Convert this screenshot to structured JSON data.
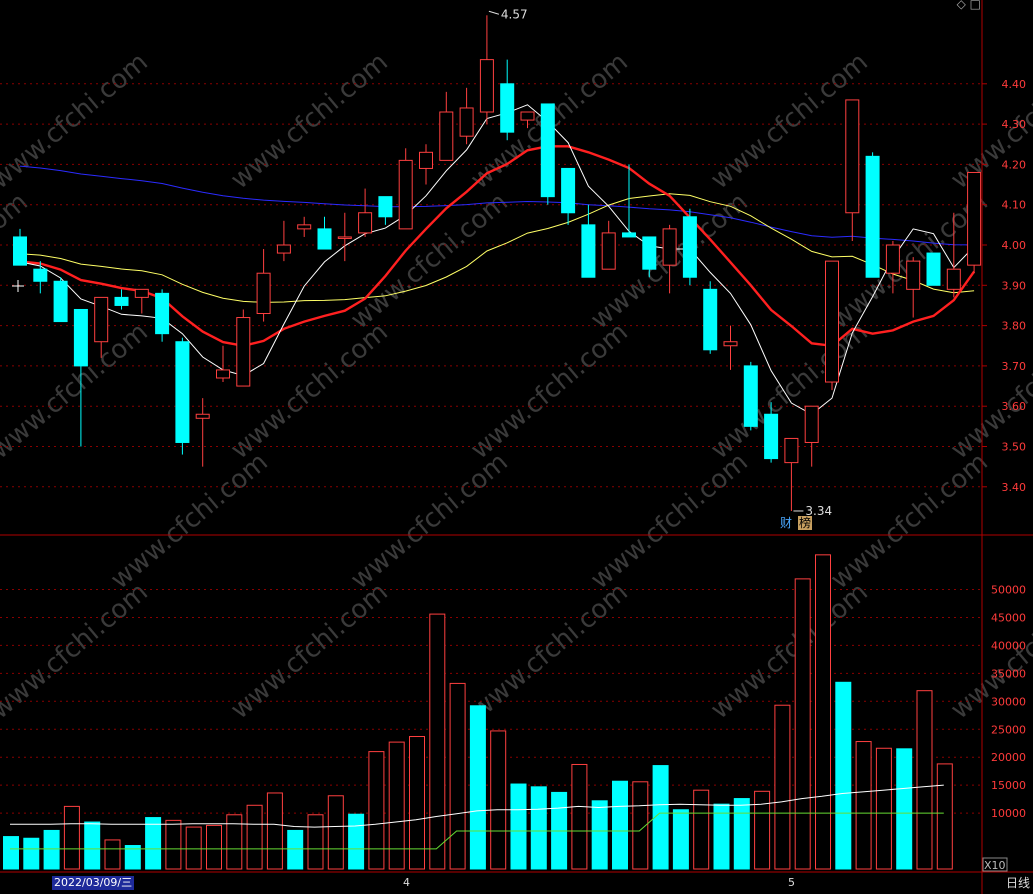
{
  "header": {
    "icons": [
      "diamond-icon",
      "square-icon"
    ]
  },
  "price_axis": {
    "ticks": [
      "4.40",
      "4.30",
      "4.20",
      "4.10",
      "4.00",
      "3.90",
      "3.80",
      "3.70",
      "3.60",
      "3.50",
      "3.40"
    ]
  },
  "volume_axis": {
    "ticks": [
      "50000",
      "45000",
      "40000",
      "35000",
      "30000",
      "25000",
      "20000",
      "15000",
      "10000"
    ],
    "unit": "X10"
  },
  "annotations": {
    "high": "4.57",
    "low": "3.34"
  },
  "badges": {
    "finance": "财",
    "list": "榜"
  },
  "footer": {
    "date": "2022/03/09/三",
    "month_4": "4",
    "month_5": "5",
    "period": "日线"
  },
  "watermark": "www.cfchi.com",
  "colors": {
    "up": "#ff4040",
    "down": "#00ffff",
    "ma5": "#ffffff",
    "ma10": "#ff2020",
    "ma20": "#ffff66",
    "ma60": "#2b2bff",
    "grid": "#8a0000"
  },
  "chart_data": {
    "type": "candlestick",
    "price_range": [
      3.34,
      4.57
    ],
    "candles": [
      {
        "o": 4.02,
        "h": 4.04,
        "l": 3.95,
        "c": 3.95
      },
      {
        "o": 3.94,
        "h": 3.96,
        "l": 3.88,
        "c": 3.91
      },
      {
        "o": 3.91,
        "h": 3.92,
        "l": 3.81,
        "c": 3.81
      },
      {
        "o": 3.84,
        "h": 3.84,
        "l": 3.5,
        "c": 3.7
      },
      {
        "o": 3.76,
        "h": 3.87,
        "l": 3.72,
        "c": 3.87
      },
      {
        "o": 3.87,
        "h": 3.89,
        "l": 3.84,
        "c": 3.85
      },
      {
        "o": 3.87,
        "h": 3.89,
        "l": 3.83,
        "c": 3.89
      },
      {
        "o": 3.88,
        "h": 3.89,
        "l": 3.76,
        "c": 3.78
      },
      {
        "o": 3.76,
        "h": 3.77,
        "l": 3.48,
        "c": 3.51
      },
      {
        "o": 3.57,
        "h": 3.62,
        "l": 3.45,
        "c": 3.58
      },
      {
        "o": 3.67,
        "h": 3.75,
        "l": 3.66,
        "c": 3.69
      },
      {
        "o": 3.65,
        "h": 3.84,
        "l": 3.65,
        "c": 3.82
      },
      {
        "o": 3.83,
        "h": 3.99,
        "l": 3.81,
        "c": 3.93
      },
      {
        "o": 3.98,
        "h": 4.06,
        "l": 3.96,
        "c": 4.0
      },
      {
        "o": 4.04,
        "h": 4.07,
        "l": 4.02,
        "c": 4.05
      },
      {
        "o": 4.04,
        "h": 4.07,
        "l": 3.99,
        "c": 3.99
      },
      {
        "o": 4.02,
        "h": 4.08,
        "l": 3.96,
        "c": 4.02
      },
      {
        "o": 4.03,
        "h": 4.14,
        "l": 4.02,
        "c": 4.08
      },
      {
        "o": 4.12,
        "h": 4.12,
        "l": 4.05,
        "c": 4.07
      },
      {
        "o": 4.04,
        "h": 4.24,
        "l": 4.04,
        "c": 4.21
      },
      {
        "o": 4.19,
        "h": 4.25,
        "l": 4.15,
        "c": 4.23
      },
      {
        "o": 4.21,
        "h": 4.38,
        "l": 4.21,
        "c": 4.33
      },
      {
        "o": 4.27,
        "h": 4.39,
        "l": 4.25,
        "c": 4.34
      },
      {
        "o": 4.33,
        "h": 4.57,
        "l": 4.3,
        "c": 4.46
      },
      {
        "o": 4.4,
        "h": 4.46,
        "l": 4.26,
        "c": 4.28
      },
      {
        "o": 4.31,
        "h": 4.33,
        "l": 4.29,
        "c": 4.33
      },
      {
        "o": 4.35,
        "h": 4.35,
        "l": 4.1,
        "c": 4.12
      },
      {
        "o": 4.19,
        "h": 4.19,
        "l": 4.05,
        "c": 4.08
      },
      {
        "o": 4.05,
        "h": 4.1,
        "l": 3.92,
        "c": 3.92
      },
      {
        "o": 3.94,
        "h": 4.06,
        "l": 3.94,
        "c": 4.03
      },
      {
        "o": 4.03,
        "h": 4.2,
        "l": 4.02,
        "c": 4.02
      },
      {
        "o": 4.02,
        "h": 4.02,
        "l": 3.92,
        "c": 3.94
      },
      {
        "o": 3.95,
        "h": 4.05,
        "l": 3.88,
        "c": 4.04
      },
      {
        "o": 4.07,
        "h": 4.09,
        "l": 3.9,
        "c": 3.92
      },
      {
        "o": 3.89,
        "h": 3.91,
        "l": 3.73,
        "c": 3.74
      },
      {
        "o": 3.75,
        "h": 3.8,
        "l": 3.69,
        "c": 3.76
      },
      {
        "o": 3.7,
        "h": 3.71,
        "l": 3.54,
        "c": 3.55
      },
      {
        "o": 3.58,
        "h": 3.61,
        "l": 3.46,
        "c": 3.47
      },
      {
        "o": 3.46,
        "h": 3.52,
        "l": 3.34,
        "c": 3.52
      },
      {
        "o": 3.51,
        "h": 3.6,
        "l": 3.45,
        "c": 3.6
      },
      {
        "o": 3.66,
        "h": 3.96,
        "l": 3.64,
        "c": 3.96
      },
      {
        "o": 4.08,
        "h": 4.36,
        "l": 4.01,
        "c": 4.36
      },
      {
        "o": 4.22,
        "h": 4.23,
        "l": 3.92,
        "c": 3.92
      },
      {
        "o": 3.93,
        "h": 4.01,
        "l": 3.88,
        "c": 4.0
      },
      {
        "o": 3.89,
        "h": 3.97,
        "l": 3.82,
        "c": 3.96
      },
      {
        "o": 3.98,
        "h": 3.98,
        "l": 3.9,
        "c": 3.9
      },
      {
        "o": 3.89,
        "h": 4.08,
        "l": 3.87,
        "c": 3.94
      },
      {
        "o": 3.95,
        "h": 4.18,
        "l": 3.93,
        "c": 4.18
      }
    ],
    "volume": [
      5800,
      5500,
      6900,
      11200,
      8400,
      5200,
      4200,
      9200,
      8700,
      7500,
      7800,
      9700,
      11400,
      13600,
      6900,
      9700,
      13100,
      9800,
      21000,
      22700,
      23700,
      45600,
      33200,
      29200,
      24700,
      15200,
      14700,
      13700,
      18700,
      12200,
      15700,
      15600,
      18500,
      10600,
      14100,
      11600,
      12600,
      13900,
      29300,
      51900,
      56200,
      33400,
      22800,
      21600,
      21500,
      31900,
      18800
    ],
    "volume_ma5": [
      8000,
      8000,
      8000,
      8100,
      8100,
      8000,
      8000,
      8000,
      8000,
      8100,
      8100,
      8100,
      8000,
      8000,
      7600,
      7500,
      7600,
      7700,
      8000,
      8400,
      8800,
      9400,
      9900,
      10400,
      10600,
      10600,
      10700,
      10900,
      11200,
      11000,
      11200,
      11300,
      11500,
      11600,
      11500,
      11400,
      11400,
      11600,
      12000,
      12600,
      13000,
      13500,
      13800,
      14100,
      14400,
      14700,
      15000
    ],
    "volume_ma10": [
      3600,
      3600,
      3600,
      3600,
      3600,
      3600,
      3600,
      3600,
      3600,
      3600,
      3600,
      3600,
      3600,
      3600,
      3600,
      3600,
      3600,
      3600,
      3600,
      3600,
      3600,
      3600,
      6800,
      6800,
      6800,
      6800,
      6800,
      6800,
      6800,
      6800,
      6800,
      6800,
      10000,
      10000,
      10000,
      10000,
      10000,
      10000,
      10000,
      10000,
      10000,
      10000,
      10000,
      10000,
      10000,
      10000,
      10000
    ]
  }
}
